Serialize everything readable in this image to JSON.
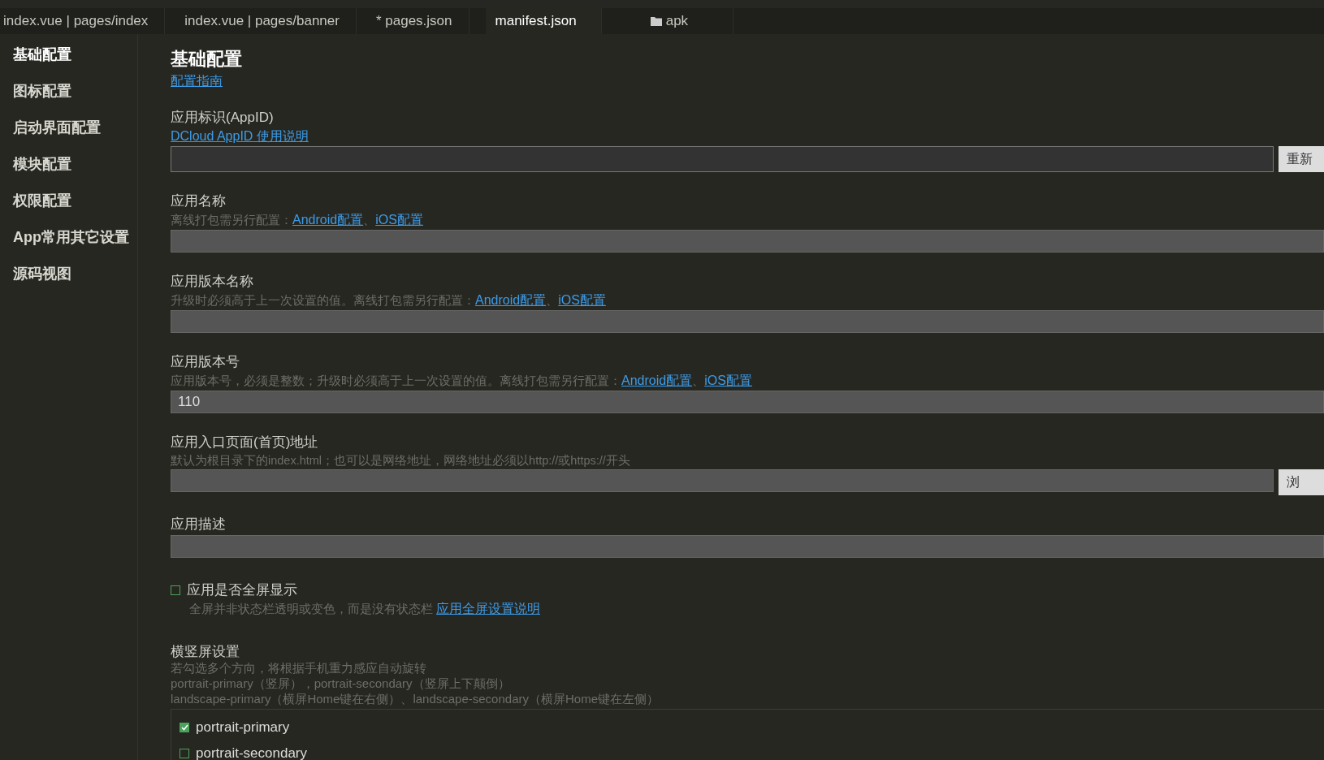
{
  "tabs": [
    {
      "label": "index.vue | pages/index",
      "selected": false,
      "kind": "file"
    },
    {
      "label": "index.vue | pages/banner",
      "selected": false,
      "kind": "file"
    },
    {
      "label": "* pages.json",
      "selected": false,
      "kind": "file"
    },
    {
      "label": "manifest.json",
      "selected": true,
      "kind": "file"
    },
    {
      "label": "apk",
      "selected": false,
      "kind": "folder"
    }
  ],
  "sidebar": {
    "items": [
      {
        "label": "基础配置",
        "selected": true
      },
      {
        "label": "图标配置",
        "selected": false
      },
      {
        "label": "启动界面配置",
        "selected": false
      },
      {
        "label": "模块配置",
        "selected": false
      },
      {
        "label": "权限配置",
        "selected": false
      },
      {
        "label": "App常用其它设置",
        "selected": false
      },
      {
        "label": "源码视图",
        "selected": false
      }
    ]
  },
  "page": {
    "title": "基础配置",
    "guide_link": "配置指南"
  },
  "fields": [
    {
      "kind": "dark-input",
      "label": "应用标识(AppID)",
      "hint": [
        {
          "link": "DCloud AppID 使用说明"
        }
      ],
      "button": "重新"
    },
    {
      "kind": "input",
      "label": "应用名称",
      "hint": [
        {
          "text": "离线打包需另行配置："
        },
        {
          "link": "Android配置"
        },
        {
          "text": "、"
        },
        {
          "link": "iOS配置"
        }
      ]
    },
    {
      "kind": "input",
      "label": "应用版本名称",
      "hint": [
        {
          "text": "升级时必须高于上一次设置的值。离线打包需另行配置："
        },
        {
          "link": "Android配置"
        },
        {
          "text": "、"
        },
        {
          "link": "iOS配置"
        }
      ]
    },
    {
      "kind": "input",
      "label": "应用版本号",
      "hint": [
        {
          "text": "应用版本号，必须是整数；升级时必须高于上一次设置的值。离线打包需另行配置："
        },
        {
          "link": "Android配置"
        },
        {
          "text": "、"
        },
        {
          "link": "iOS配置"
        }
      ],
      "value": "110"
    },
    {
      "kind": "input",
      "label": "应用入口页面(首页)地址",
      "hint": [
        {
          "text": "默认为根目录下的index.html；也可以是网络地址，网络地址必须以http://或https://开头"
        }
      ],
      "button": "浏"
    },
    {
      "kind": "input",
      "label": "应用描述"
    },
    {
      "kind": "checkbox",
      "label": "应用是否全屏显示",
      "checked": false,
      "hint": [
        {
          "text": "全屏并非状态栏透明或变色，而是没有状态栏 "
        },
        {
          "link": "应用全屏设置说明"
        }
      ]
    },
    {
      "kind": "checklist",
      "label": "横竖屏设置",
      "notes": [
        "若勾选多个方向，将根据手机重力感应自动旋转",
        "portrait-primary（竖屏），portrait-secondary（竖屏上下颠倒）",
        "landscape-primary（横屏Home键在右侧）、landscape-secondary（横屏Home键在左侧）"
      ],
      "options": [
        {
          "label": "portrait-primary",
          "checked": true
        },
        {
          "label": "portrait-secondary",
          "checked": false
        }
      ]
    }
  ]
}
